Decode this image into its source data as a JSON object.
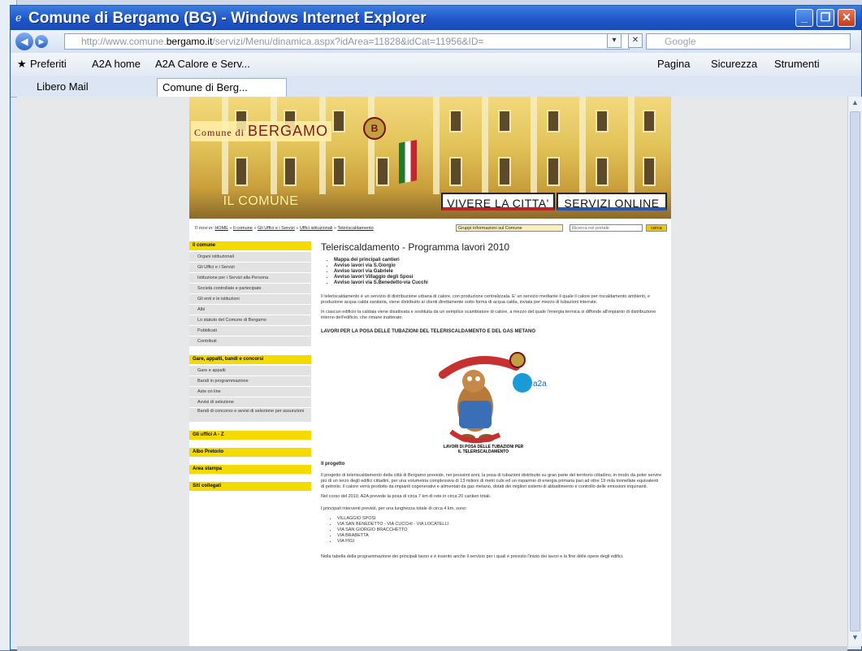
{
  "window": {
    "title": "Comune di Bergamo (BG) - Windows Internet Explorer",
    "minimize": "_",
    "maximize": "❐",
    "close": "✕"
  },
  "address": {
    "prefix": "http://www.comune.",
    "domain": "bergamo.it",
    "path": "/servizi/Menu/dinamica.aspx?idArea=11828&idCat=11956&ID=",
    "search_placeholder": "Google"
  },
  "favorites": {
    "label": "Preferiti",
    "items": [
      "A2A home",
      "A2A Calore e Serv..."
    ]
  },
  "commandbar": [
    "Pagina",
    "Sicurezza",
    "Strumenti"
  ],
  "tabs": [
    {
      "label": "Libero Mail"
    },
    {
      "label": "Comune di Berg..."
    }
  ],
  "site": {
    "logo_small": "Comune di",
    "logo_big": "BERGAMO",
    "nav": [
      "IL COMUNE",
      "VIVERE LA CITTA'",
      "SERVIZI ONLINE"
    ],
    "breadcrumb_prefix": "Ti trovi in:",
    "breadcrumb": [
      "HOME",
      "Il comune",
      "Gli Uffici e i Servizi",
      "Uffici istituzionali",
      "Teleriscaldamento"
    ],
    "select_value": "Gruppi informazioni sul Comune",
    "search_placeholder": "Ricerca nel portale",
    "search_button": "cerca",
    "menu_sections": [
      {
        "title": "Il comune",
        "items": [
          "Organi istituzionali",
          "Gli Uffici e i Servizi",
          "Istituzione per i Servizi alla Persona",
          "Società controllate e partecipate",
          "Gli enti e le istituzioni",
          "Albi",
          "Lo statuto del Comune di Bergamo",
          "Pubblicati",
          "Contributi"
        ]
      },
      {
        "title": "Gare, appalti, bandi e concorsi",
        "items": [
          "Gare e appalti",
          "Bandi in programmazione",
          "Aste on line",
          "Avvisi di selezione",
          "Bandi di concorso e avvisi di selezione per assunzioni"
        ]
      }
    ],
    "menu_extra": [
      "Gli uffici A - Z",
      "Albo Pretorio",
      "Area stampa",
      "Siti collegati"
    ],
    "heading": "Teleriscaldamento - Programma lavori 2010",
    "bullets": [
      "Mappa dei principali cantieri",
      "Avviso lavori via S.Giorgio",
      "Avviso lavori via Gabriele",
      "Avviso lavori Villaggio degli Sposi",
      "Avviso lavori via S.Benedetto-via Cucchi"
    ],
    "paragraphs": [
      "Il teleriscaldamento è un servizio di distribuzione urbana di calore, con produzione centralizzata. E' un servizio mediante il quale il calore per riscaldamento ambienti, e produzione acqua calda sanitaria, viene distribuito ai clienti direttamente sotto forma di acqua calda, inviata per mezzo di tubazioni interrate.",
      "In ciascun edificio la caldaia viene disattivata e sostituita da un semplice scambiatore di calore, a mezzo del quale l'energia termica si diffonde all'impianto di distribuzione interno dell'edificio, che rimane inalterato."
    ],
    "works_heading": "LAVORI PER LA POSA DELLE TUBAZIONI DEL TELERISCALDAMENTO E DEL GAS METANO",
    "illustration_caption": "LAVORI DI POSA DELLE TUBAZIONI PER IL TELERISCALDAMENTO",
    "a2a_label": "a2a",
    "project_heading": "Il progetto",
    "project_paragraphs": [
      "Il progetto di teleriscaldamento della città di Bergamo prevede, nei prossimi anni, la posa di tubazioni distribuite su gran parte del territorio cittadino, in modo da poter servire più di un terzo degli edifici cittadini, per una volumetria complessiva di 13 milioni di metri cubi ed un risparmio di energia primaria pari ad oltre 19 mila tonnellate equivalenti di petrolio. Il calore verrà prodotto da impianti cogenerativi e alimentati da gas metano, dotati dei migliori sistemi di abbattimento e controllo delle emissioni inquinanti.",
      "Nel corso del 2010, A2A prevede la posa di circa 7 km di rete in circa 20 cantieri totali.",
      "I principali interventi previsti, per una lunghezza totale di circa 4 km, sono:"
    ],
    "streets": [
      "VILLAGGIO SPOSI",
      "VIA SAN BENEDETTO - VIA CUCCHI - VIA LOCATELLI",
      "VIA SAN GIORGIO BRACCHETTO",
      "VIA BRABETTA",
      "VIA PIGI"
    ],
    "footer_text": "Nella tabella della programmazione dei principali lavori e è inserito anche il servizio per i quali è previsto l'inizio dei lavori e la fine delle opere degli edifici."
  }
}
